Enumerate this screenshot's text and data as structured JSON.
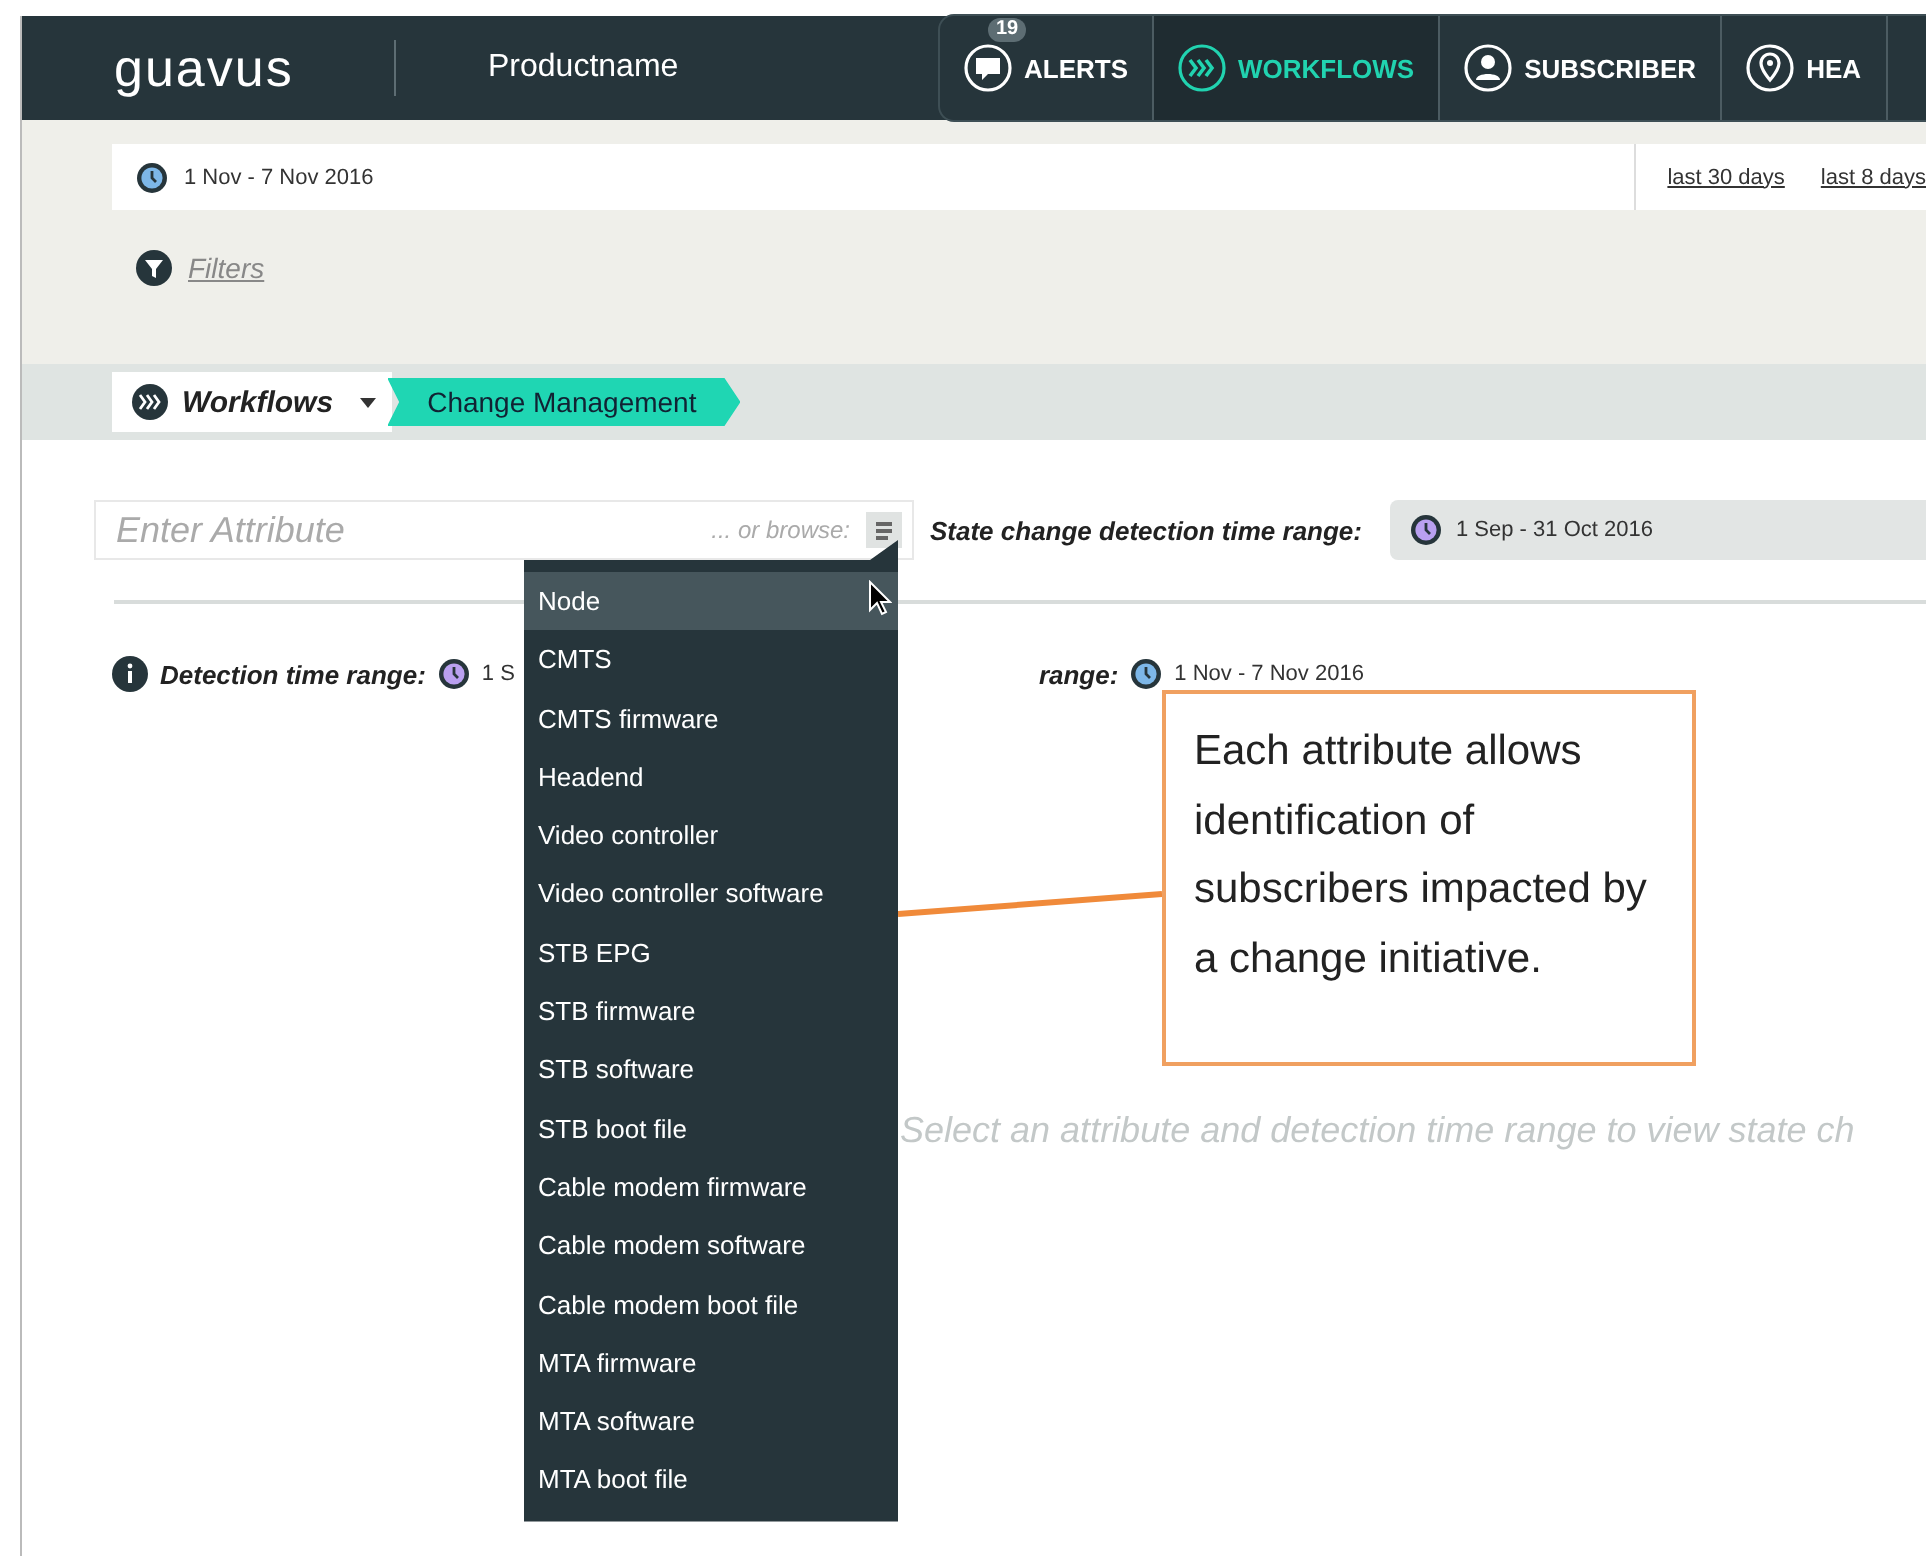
{
  "nav": {
    "logo": "guavus",
    "product": "Productname",
    "tabs": [
      {
        "label": "ALERTS",
        "kind": "alert",
        "badge": "19",
        "selected": false
      },
      {
        "label": "WORKFLOWS",
        "kind": "workflow",
        "selected": true
      },
      {
        "label": "SUBSCRIBER",
        "kind": "user",
        "selected": false
      },
      {
        "label": "HEA",
        "kind": "pin",
        "selected": false
      }
    ]
  },
  "date_bar": {
    "range": "1 Nov - 7 Nov 2016",
    "links": [
      "last 30 days",
      "last 8 days"
    ]
  },
  "filters": {
    "label": "Filters"
  },
  "breadcrumb": {
    "menu": "Workflows",
    "current": "Change Management"
  },
  "attribute": {
    "placeholder": "Enter Attribute",
    "browse": "... or browse:",
    "state_label": "State change detection time range:",
    "state_range": "1 Sep - 31 Oct 2016"
  },
  "detection": {
    "label": "Detection time range:",
    "range": "1 S",
    "second_label": "range:",
    "second_range": "1 Nov - 7 Nov 2016"
  },
  "dropdown": {
    "items": [
      {
        "label": "Node",
        "selected": true
      },
      {
        "label": "CMTS",
        "selected": false
      },
      {
        "label": "CMTS firmware",
        "selected": false
      },
      {
        "label": "Headend",
        "selected": false
      },
      {
        "label": "Video controller",
        "selected": false
      },
      {
        "label": "Video controller software",
        "selected": false
      },
      {
        "label": "STB EPG",
        "selected": false
      },
      {
        "label": "STB firmware",
        "selected": false
      },
      {
        "label": "STB software",
        "selected": false
      },
      {
        "label": "STB boot file",
        "selected": false
      },
      {
        "label": "Cable modem firmware",
        "selected": false
      },
      {
        "label": "Cable modem software",
        "selected": false
      },
      {
        "label": "Cable modem boot file",
        "selected": false
      },
      {
        "label": "MTA firmware",
        "selected": false
      },
      {
        "label": "MTA software",
        "selected": false
      },
      {
        "label": "MTA boot file",
        "selected": false
      }
    ]
  },
  "callout": {
    "text": "Each attribute allows identification of subscribers impacted by a change initiative."
  },
  "hint": "Select an attribute and detection time range to view state ch"
}
